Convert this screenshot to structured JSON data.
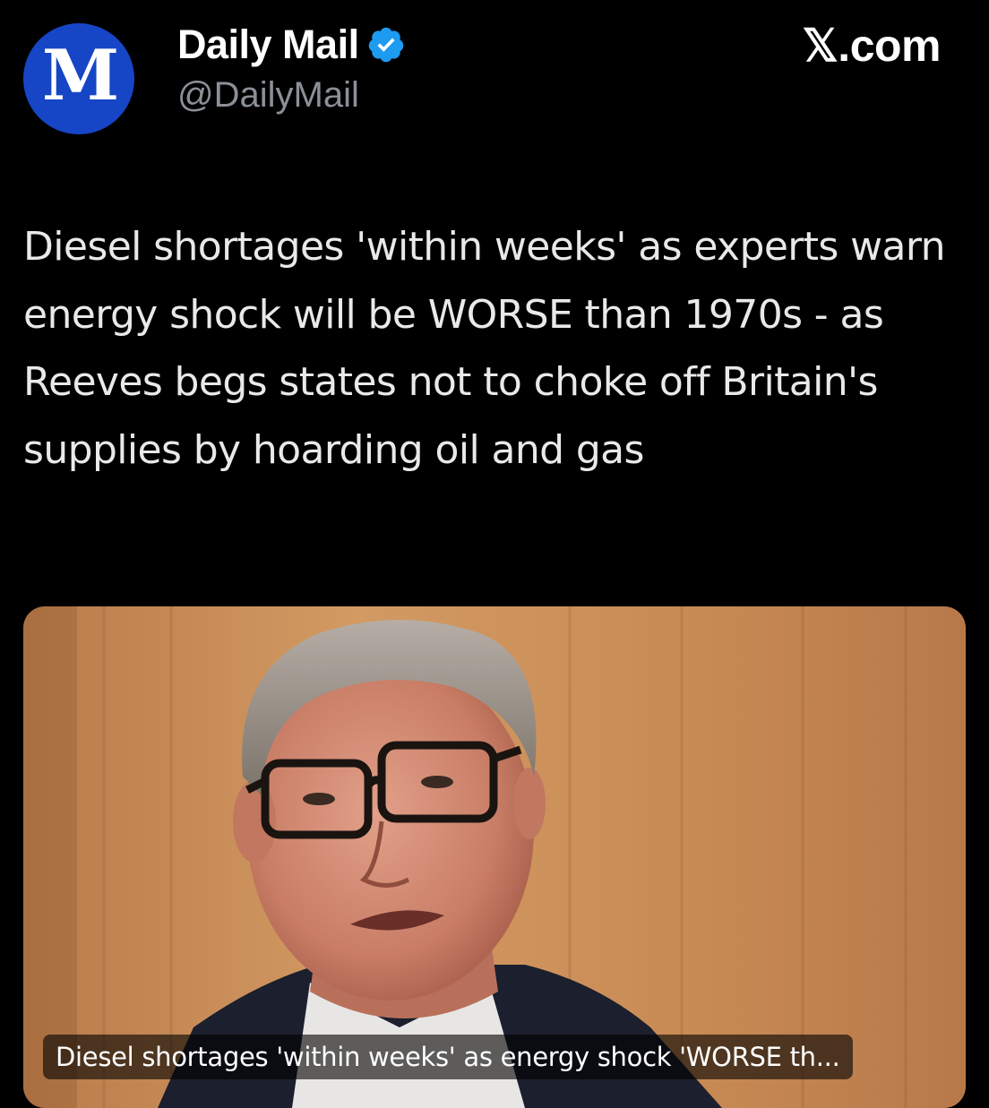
{
  "account": {
    "display_name": "Daily Mail",
    "handle": "@DailyMail",
    "avatar_letters": "M",
    "verified": true
  },
  "source": {
    "label": "𝕏.com"
  },
  "post": {
    "text": "Diesel shortages 'within weeks' as experts warn energy shock will be WORSE than 1970s - as Reeves begs states not to choke off Britain's supplies by hoarding oil and gas"
  },
  "media": {
    "caption": "Diesel shortages 'within weeks' as energy shock 'WORSE th..."
  },
  "colors": {
    "background": "#000000",
    "avatar_blue": "#1646c6",
    "verified_blue": "#1d9bf0",
    "handle_gray": "#8b9098",
    "text": "#e7e9ea"
  },
  "icons": {
    "verified": "verified-badge-icon",
    "brand": "x-logo"
  }
}
